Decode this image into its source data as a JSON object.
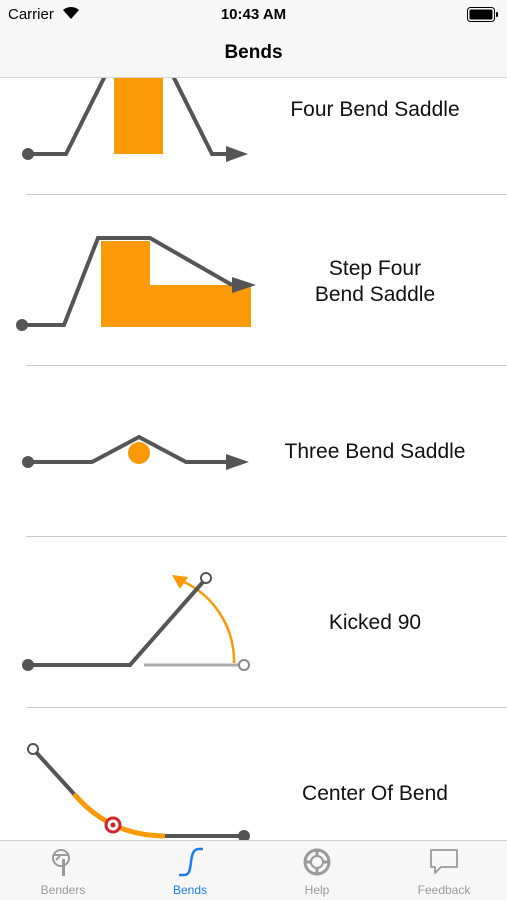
{
  "status_bar": {
    "carrier": "Carrier",
    "time": "10:43 AM"
  },
  "nav": {
    "title": "Bends"
  },
  "bends": [
    {
      "label": "Four Bend Saddle"
    },
    {
      "label": "Step Four\nBend Saddle"
    },
    {
      "label": "Three Bend Saddle"
    },
    {
      "label": "Kicked 90"
    },
    {
      "label": "Center Of Bend"
    }
  ],
  "tabs": [
    {
      "label": "Benders",
      "icon": "bender-tool-icon",
      "active": false
    },
    {
      "label": "Bends",
      "icon": "bend-curve-icon",
      "active": true
    },
    {
      "label": "Help",
      "icon": "lifebuoy-icon",
      "active": false
    },
    {
      "label": "Feedback",
      "icon": "speech-bubble-icon",
      "active": false
    }
  ],
  "colors": {
    "accent": "#1a7cf5",
    "orange": "#fb9a06",
    "line": "#555555",
    "bar_background": "#f7f7f7"
  }
}
